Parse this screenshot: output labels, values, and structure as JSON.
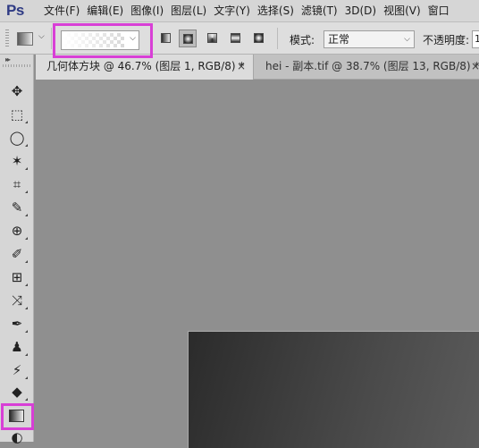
{
  "app": {
    "logo": "Ps"
  },
  "menu": [
    "文件(F)",
    "编辑(E)",
    "图像(I)",
    "图层(L)",
    "文字(Y)",
    "选择(S)",
    "滤镜(T)",
    "3D(D)",
    "视图(V)",
    "窗口"
  ],
  "options": {
    "mode_label": "模式:",
    "mode_value": "正常",
    "opacity_label": "不透明度:",
    "opacity_value": "1"
  },
  "tabs": [
    {
      "title": "几何体方块 @ 46.7% (图层 1, RGB/8) *",
      "close": "×"
    },
    {
      "title": "hei - 副本.tif @ 38.7% (图层 13, RGB/8) *",
      "close": "×"
    }
  ],
  "toolbar": {
    "collapse": "▸▸"
  },
  "tools": [
    {
      "name": "move-icon",
      "glyph": "✥"
    },
    {
      "name": "marquee-icon",
      "glyph": "⬚"
    },
    {
      "name": "lasso-icon",
      "glyph": "◯"
    },
    {
      "name": "magic-wand-icon",
      "glyph": "✶"
    },
    {
      "name": "crop-icon",
      "glyph": "⌗"
    },
    {
      "name": "eyedropper-icon",
      "glyph": "✎"
    },
    {
      "name": "healing-brush-icon",
      "glyph": "⊕"
    },
    {
      "name": "brush-icon",
      "glyph": "✐"
    },
    {
      "name": "clone-stamp-icon",
      "glyph": "⊞"
    },
    {
      "name": "history-brush-icon",
      "glyph": "⤨"
    },
    {
      "name": "eraser-icon",
      "glyph": "✒"
    },
    {
      "name": "stamp-icon",
      "glyph": "♟"
    },
    {
      "name": "art-brush-icon",
      "glyph": "⚡"
    },
    {
      "name": "eraser-tool-icon",
      "glyph": "◆"
    },
    {
      "name": "blur-icon",
      "glyph": "◐"
    }
  ],
  "colors": {
    "highlight": "#d83fd6",
    "ps_logo": "#2f3b84"
  }
}
